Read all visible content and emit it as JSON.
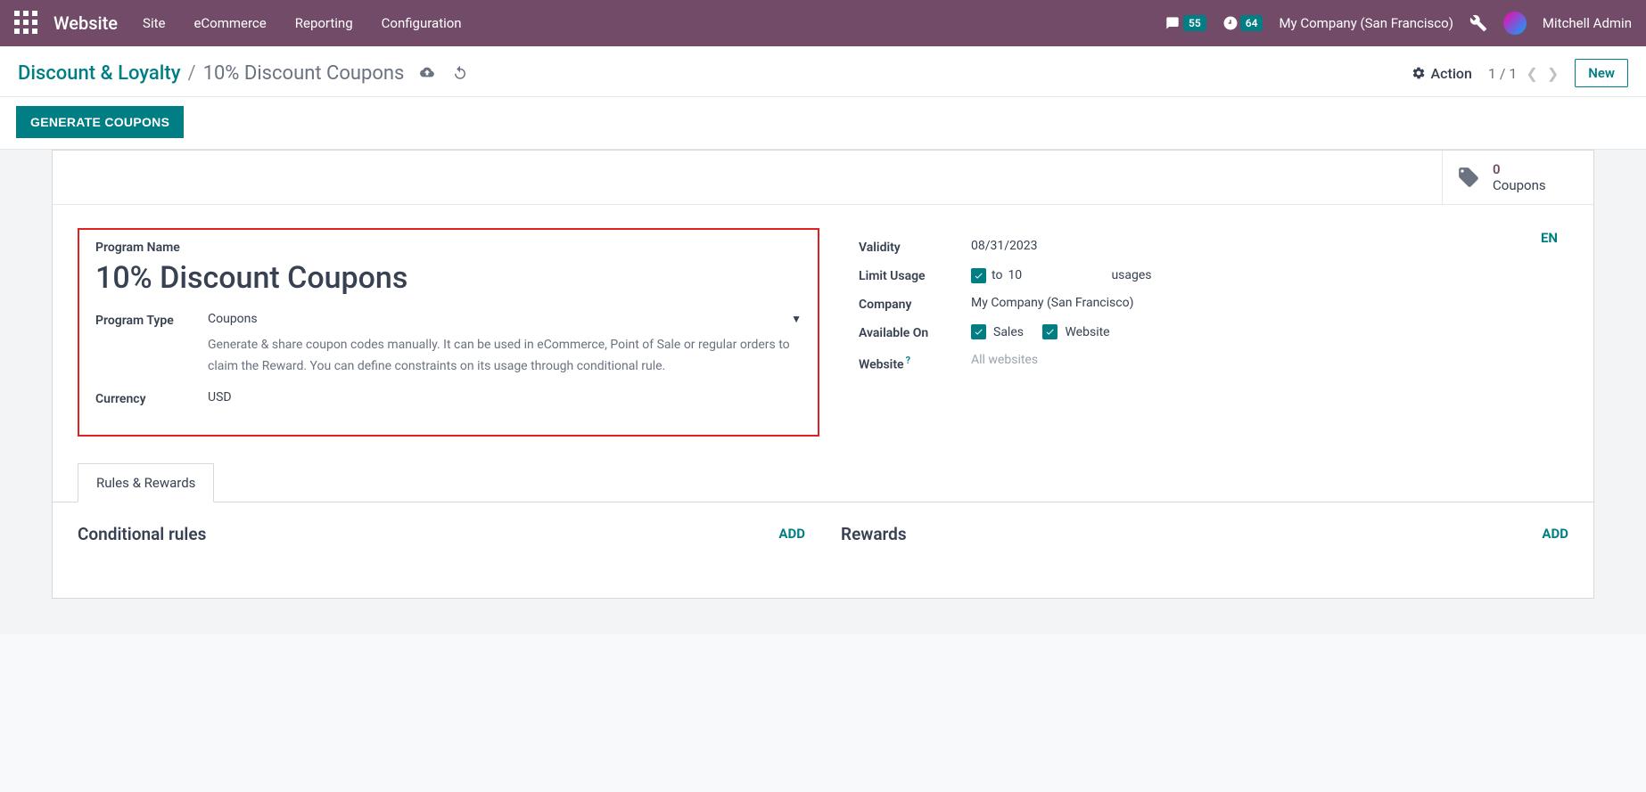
{
  "navbar": {
    "brand": "Website",
    "items": [
      "Site",
      "eCommerce",
      "Reporting",
      "Configuration"
    ],
    "messages_count": "55",
    "activities_count": "64",
    "company": "My Company (San Francisco)",
    "user": "Mitchell Admin"
  },
  "breadcrumb": {
    "parent": "Discount & Loyalty",
    "current": "10% Discount Coupons",
    "action_label": "Action",
    "pager": "1 / 1",
    "new_label": "New"
  },
  "subbar": {
    "generate_label": "GENERATE COUPONS"
  },
  "statbox": {
    "count": "0",
    "label": "Coupons"
  },
  "form": {
    "lang_badge": "EN",
    "program_name_label": "Program Name",
    "program_name": "10% Discount Coupons",
    "program_type_label": "Program Type",
    "program_type": "Coupons",
    "program_type_help": "Generate & share coupon codes manually. It can be used in eCommerce, Point of Sale or regular orders to claim the Reward. You can define constraints on its usage through conditional rule.",
    "currency_label": "Currency",
    "currency": "USD",
    "validity_label": "Validity",
    "validity": "08/31/2023",
    "limit_usage_label": "Limit Usage",
    "limit_to": "to",
    "limit_value": "10",
    "limit_suffix": "usages",
    "company_label": "Company",
    "company_value": "My Company (San Francisco)",
    "available_on_label": "Available On",
    "avail_sales": "Sales",
    "avail_website": "Website",
    "website_label": "Website",
    "website_value": "All websites"
  },
  "tabs": {
    "rules_rewards": "Rules & Rewards"
  },
  "sections": {
    "rules_title": "Conditional rules",
    "rewards_title": "Rewards",
    "add_label": "ADD"
  }
}
